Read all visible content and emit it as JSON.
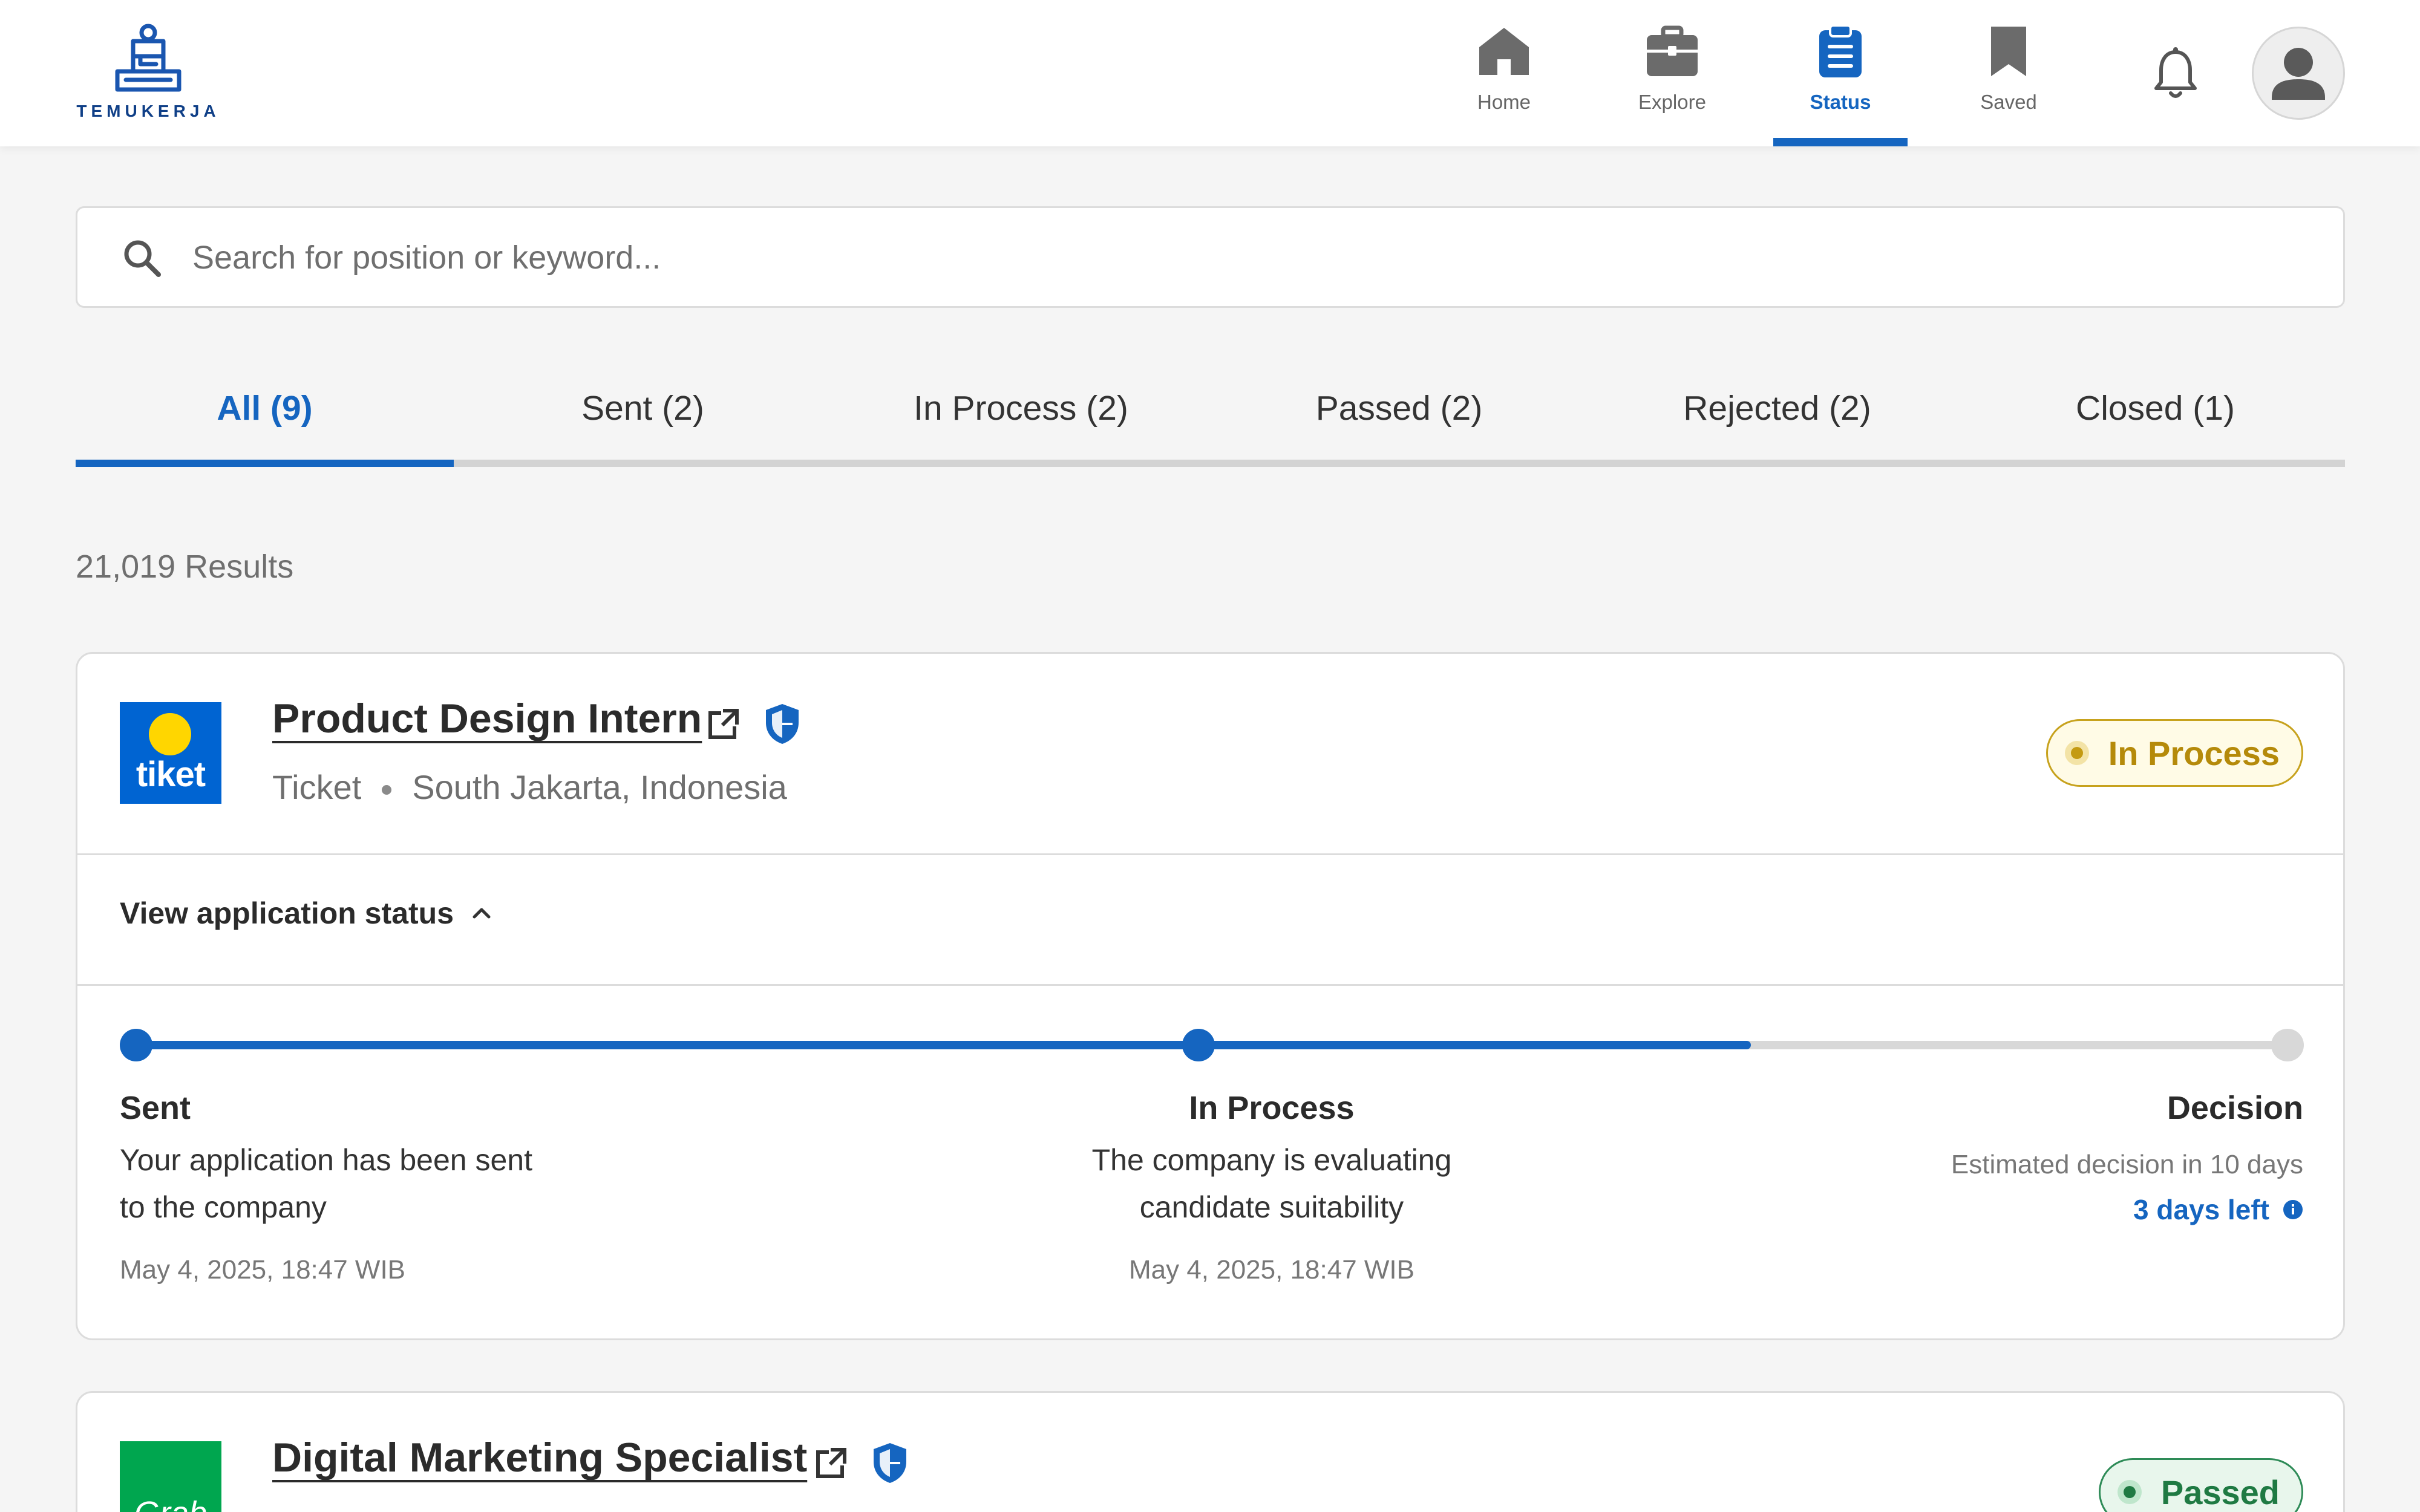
{
  "app": {
    "logo_text": "TEMUKERJA"
  },
  "nav": {
    "items": [
      {
        "label": "Home",
        "icon": "home-icon",
        "active": false
      },
      {
        "label": "Explore",
        "icon": "briefcase-icon",
        "active": false
      },
      {
        "label": "Status",
        "icon": "clipboard-icon",
        "active": true
      },
      {
        "label": "Saved",
        "icon": "bookmark-icon",
        "active": false
      }
    ],
    "notification_icon": "bell-icon",
    "profile_icon": "avatar-icon"
  },
  "search": {
    "placeholder": "Search for position or keyword...",
    "value": ""
  },
  "tabs": [
    {
      "label": "All (9)",
      "active": true
    },
    {
      "label": "Sent (2)",
      "active": false
    },
    {
      "label": "In Process (2)",
      "active": false
    },
    {
      "label": "Passed (2)",
      "active": false
    },
    {
      "label": "Rejected (2)",
      "active": false
    },
    {
      "label": "Closed (1)",
      "active": false
    }
  ],
  "results_count": "21,019 Results",
  "colors": {
    "accent": "#1565c0",
    "in_process": "#b58a0a",
    "passed": "#1f7a43",
    "tiket_brand": "#0064d2",
    "grab_brand": "#00a64f"
  },
  "jobs": [
    {
      "title": "Product Design Intern",
      "company": "Ticket",
      "company_logo_text": "tiket",
      "location": "South Jakarta, Indonesia",
      "status": "In Process",
      "view_status_label": "View application status",
      "steps": [
        {
          "title": "Sent",
          "desc_line1": "Your application has been sent",
          "desc_line2": "to the company",
          "time": "May 4, 2025, 18:47 WIB"
        },
        {
          "title": "In Process",
          "desc_line1": "The company is evaluating",
          "desc_line2": "candidate suitability",
          "time": "May 4, 2025, 18:47 WIB"
        },
        {
          "title": "Decision",
          "estimate": "Estimated decision in 10 days",
          "days_left": "3 days left"
        }
      ]
    },
    {
      "title": "Digital Marketing Specialist",
      "company_logo_text": "Grab",
      "status": "Passed"
    }
  ]
}
